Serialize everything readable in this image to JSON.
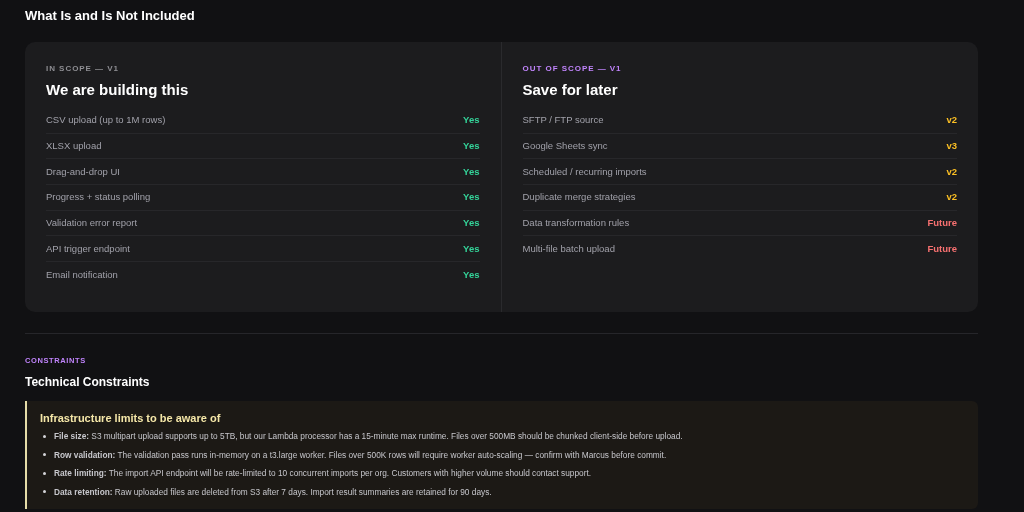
{
  "scope": {
    "title": "What Is and Is Not Included",
    "columns": [
      {
        "eyebrow": "IN SCOPE — V1",
        "color": "#8e8e93",
        "heading": "We are building this",
        "items": [
          {
            "label": "CSV upload (up to 1M rows)",
            "status": "Yes",
            "color": "#34d399"
          },
          {
            "label": "XLSX upload",
            "status": "Yes",
            "color": "#34d399"
          },
          {
            "label": "Drag-and-drop UI",
            "status": "Yes",
            "color": "#34d399"
          },
          {
            "label": "Progress + status polling",
            "status": "Yes",
            "color": "#34d399"
          },
          {
            "label": "Validation error report",
            "status": "Yes",
            "color": "#34d399"
          },
          {
            "label": "API trigger endpoint",
            "status": "Yes",
            "color": "#34d399"
          },
          {
            "label": "Email notification",
            "status": "Yes",
            "color": "#34d399"
          }
        ]
      },
      {
        "eyebrow": "OUT OF SCOPE — V1",
        "color": "#c084fc",
        "heading": "Save for later",
        "items": [
          {
            "label": "SFTP / FTP source",
            "status": "v2",
            "color": "#fbbf24"
          },
          {
            "label": "Google Sheets sync",
            "status": "v3",
            "color": "#fbbf24"
          },
          {
            "label": "Scheduled / recurring imports",
            "status": "v2",
            "color": "#fbbf24"
          },
          {
            "label": "Duplicate merge strategies",
            "status": "v2",
            "color": "#fbbf24"
          },
          {
            "label": "Data transformation rules",
            "status": "Future",
            "color": "#f87171"
          },
          {
            "label": "Multi-file batch upload",
            "status": "Future",
            "color": "#f87171"
          }
        ]
      }
    ]
  },
  "constraints": {
    "eyebrow": "CONSTRAINTS",
    "title": "Technical Constraints",
    "callout": {
      "title": "Infrastructure limits to be aware of",
      "items": [
        "**File size:** S3 multipart upload supports up to 5TB, but our Lambda processor has a 15-minute max runtime. Files over 500MB should be chunked client-side before upload.",
        "**Row validation:** The validation pass runs in-memory on a t3.large worker. Files over 500K rows will require worker auto-scaling — confirm with Marcus before commit.",
        "**Rate limiting:** The import API endpoint will be rate-limited to 10 concurrent imports per org. Customers with higher volume should contact support.",
        "**Data retention:** Raw uploaded files are deleted from S3 after 7 days. Import result summaries are retained for 90 days."
      ]
    }
  }
}
